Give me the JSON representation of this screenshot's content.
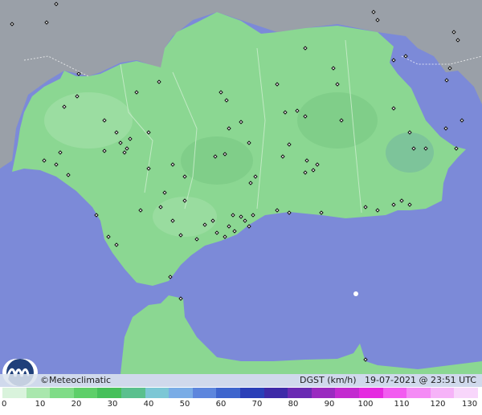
{
  "credit": "©Meteoclimatic",
  "variable": "DGST (km/h)",
  "date": "19-07-2021",
  "time": "23:51 UTC",
  "scale": {
    "ticks": [
      "0",
      "10",
      "20",
      "30",
      "40",
      "50",
      "60",
      "70",
      "80",
      "90",
      "100",
      "110",
      "120",
      "130"
    ],
    "colors": [
      "#d9f3dc",
      "#a9e7ad",
      "#7fdc87",
      "#5ecf69",
      "#46c05a",
      "#5ac08e",
      "#7cc7d5",
      "#79ace6",
      "#5d86dd",
      "#3e65cd",
      "#2a3fb8",
      "#3e2aa8",
      "#6a2ab3",
      "#9a2ac0",
      "#c32ad0",
      "#e52ae0",
      "#f25cf0",
      "#f48bf5",
      "#f6b3f8",
      "#f8d6fb"
    ]
  },
  "colors": {
    "sea": "#7c8ad8",
    "land": "#8bd792",
    "mountains": "#9aa0a8",
    "stations": "#ffffff"
  }
}
